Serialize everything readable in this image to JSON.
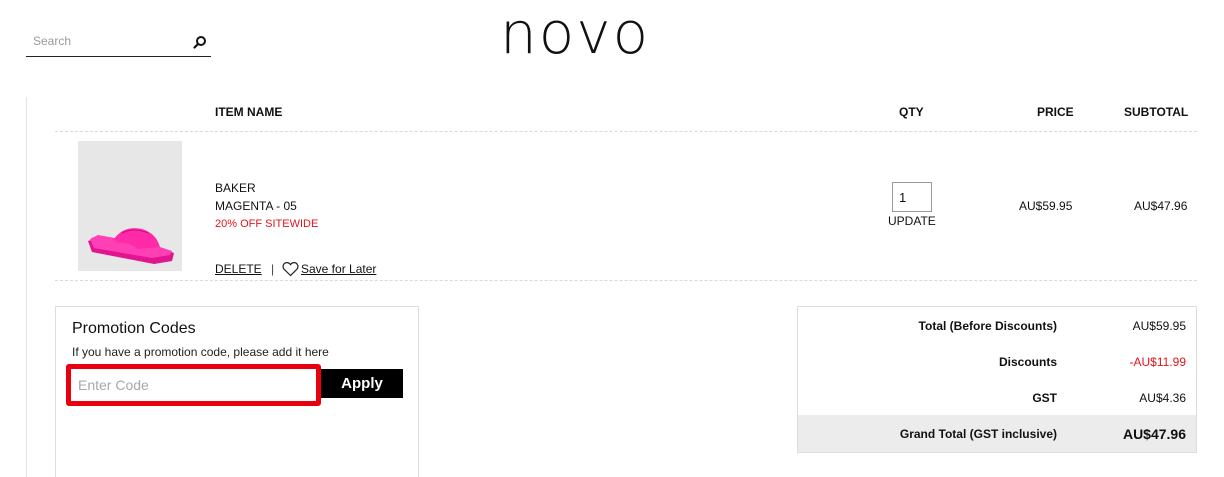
{
  "header": {
    "search_placeholder": "Search",
    "logo": "novo"
  },
  "cart": {
    "columns": {
      "item_name": "ITEM NAME",
      "qty": "QTY",
      "price": "PRICE",
      "subtotal": "SUBTOTAL"
    },
    "item": {
      "name": "BAKER",
      "variant": "MAGENTA - 05",
      "promo": "20% OFF SITEWIDE",
      "qty": "1",
      "update_label": "UPDATE",
      "price": "AU$59.95",
      "subtotal": "AU$47.96",
      "delete_label": "DELETE",
      "separator": "|",
      "save_label": "Save for Later",
      "image_icon": "pink-platform-slide-sandal"
    }
  },
  "promotion": {
    "title": "Promotion Codes",
    "subtitle": "If you have a promotion code, please add it here",
    "placeholder": "Enter Code",
    "apply_label": "Apply"
  },
  "totals": {
    "before_discounts_label": "Total (Before Discounts)",
    "before_discounts_value": "AU$59.95",
    "discounts_label": "Discounts",
    "discounts_value": "-AU$11.99",
    "gst_label": "GST",
    "gst_value": "AU$4.36",
    "grand_label": "Grand Total (GST inclusive)",
    "grand_value": "AU$47.96"
  },
  "colors": {
    "accent_red": "#e3141b",
    "highlight_red": "#e8000d",
    "button_black": "#000000"
  }
}
